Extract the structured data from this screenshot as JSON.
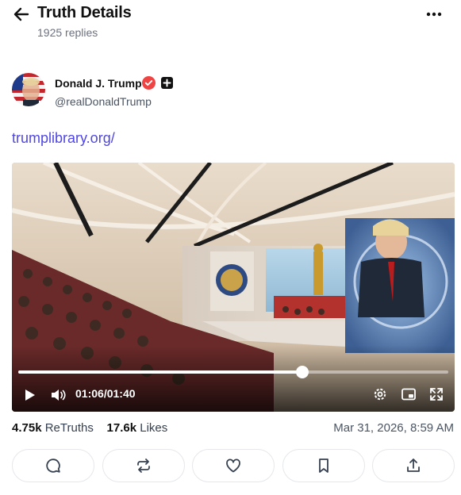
{
  "header": {
    "title": "Truth Details",
    "replies": "1925 replies",
    "back_icon": "arrow-left-icon",
    "more_icon": "more-horizontal-icon"
  },
  "author": {
    "name": "Donald J. Trump",
    "handle": "@realDonaldTrump",
    "verified_color": "#ef4444"
  },
  "post": {
    "link_text": "trumplibrary.org/",
    "link_color": "#4f46e5"
  },
  "video": {
    "current_time": "01:06",
    "separator": "/",
    "duration": "01:40",
    "progress": 0.66
  },
  "stats": {
    "retruths_count": "4.75k",
    "retruths_label": "ReTruths",
    "likes_count": "17.6k",
    "likes_label": "Likes",
    "date": "Mar 31, 2026, 8:59 AM"
  },
  "actions": [
    "reply-icon",
    "retruth-icon",
    "like-icon",
    "bookmark-icon",
    "share-icon"
  ]
}
